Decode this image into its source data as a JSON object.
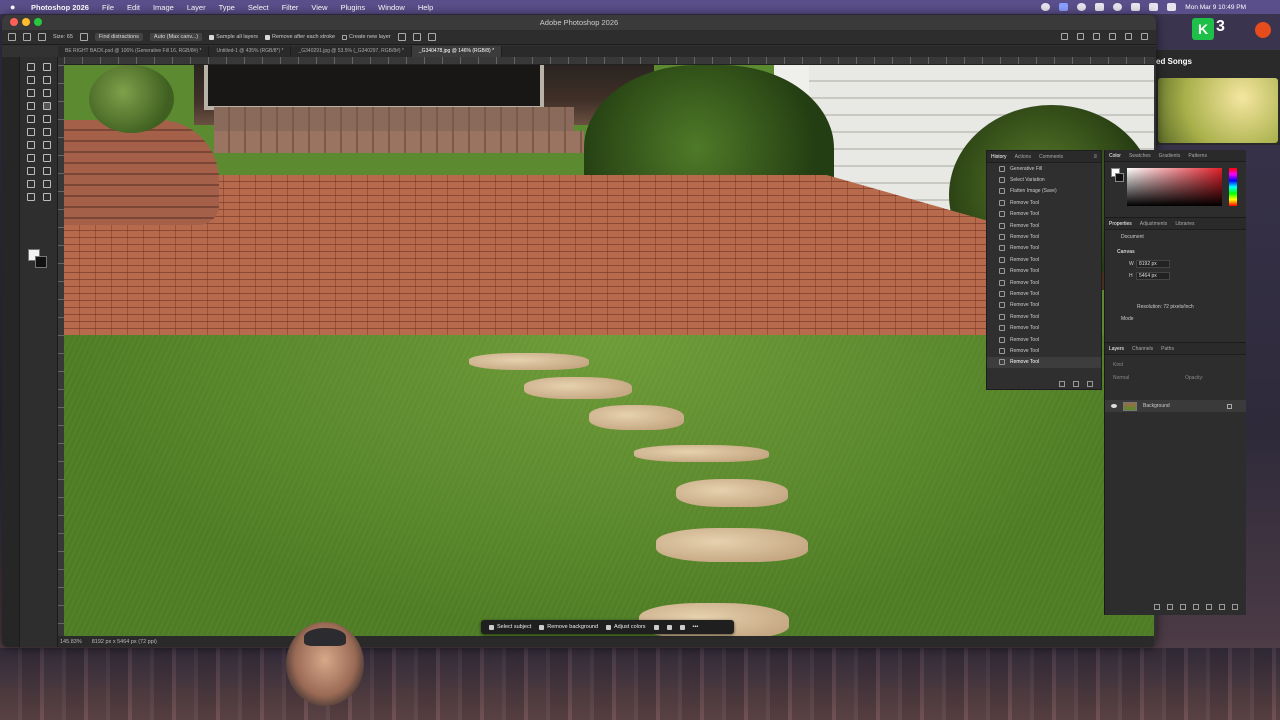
{
  "menubar": {
    "app_name": "Photoshop 2026",
    "items": [
      "File",
      "Edit",
      "Image",
      "Layer",
      "Type",
      "Select",
      "Filter",
      "View",
      "Plugins",
      "Window",
      "Help"
    ],
    "datetime": "Mon Mar 9 10:49 PM"
  },
  "window": {
    "title": "Adobe Photoshop 2026"
  },
  "options_bar": {
    "size_label": "Size: 65",
    "find_distractions": "Find distractions",
    "mode": "Auto (Max canv...)",
    "sample_all_layers": "Sample all layers",
    "remove_after_stroke": "Remove after each stroke",
    "create_new_layer": "Create new layer"
  },
  "doc_tabs": [
    {
      "label": "BE RIGHT BACK.psd @ 106% (Generative Fill 16, RGB/8#) *",
      "active": false
    },
    {
      "label": "Untitled-1 @ 435% (RGB/8*) *",
      "active": false
    },
    {
      "label": "_G340291.jpg @ 53.5% (_G340297, RGB/8#) *",
      "active": false
    },
    {
      "label": "_G340478.jpg @ 146% (RGB/8) *",
      "active": true
    }
  ],
  "history_panel": {
    "tabs": [
      "History",
      "Actions",
      "Comments"
    ],
    "items": [
      "Generative Fill",
      "Select Variation",
      "Flatten Image (Save)",
      "Remove Tool",
      "Remove Tool",
      "Remove Tool",
      "Remove Tool",
      "Remove Tool",
      "Remove Tool",
      "Remove Tool",
      "Remove Tool",
      "Remove Tool",
      "Remove Tool",
      "Remove Tool",
      "Remove Tool",
      "Remove Tool",
      "Remove Tool",
      "Remove Tool"
    ],
    "selected_index": 17
  },
  "color_panel": {
    "tabs": [
      "Color",
      "Swatches",
      "Gradients",
      "Patterns"
    ]
  },
  "properties_panel": {
    "tabs": [
      "Properties",
      "Adjustments",
      "Libraries"
    ],
    "document_label": "Document",
    "canvas_label": "Canvas",
    "width_label": "W",
    "width_value": "8192 px",
    "height_label": "H",
    "height_value": "5464 px",
    "resolution": "Resolution: 72 pixels/inch",
    "mode_label": "Mode"
  },
  "layers_panel": {
    "tabs": [
      "Layers",
      "Channels",
      "Paths"
    ],
    "search_placeholder": "Kind",
    "blend_mode": "Normal",
    "opacity": "Opacity:",
    "layers": [
      {
        "name": "Background"
      }
    ]
  },
  "status_bar": {
    "zoom": "145.83%",
    "info": "8192 px x 5464 px (72 ppi)"
  },
  "taskbar": {
    "select_subject": "Select subject",
    "remove_background": "Remove background",
    "adjust_colors": "Adjust colors"
  },
  "music_widget": {
    "title": "ed Songs"
  },
  "stream_badge": {
    "count": "3"
  },
  "colors": {
    "menubar": "#5a4f8a",
    "ps_bg": "#323232",
    "panel_bg": "#2f2f2f",
    "lawn": "#5a8a2c",
    "brick": "#b86a4c"
  }
}
